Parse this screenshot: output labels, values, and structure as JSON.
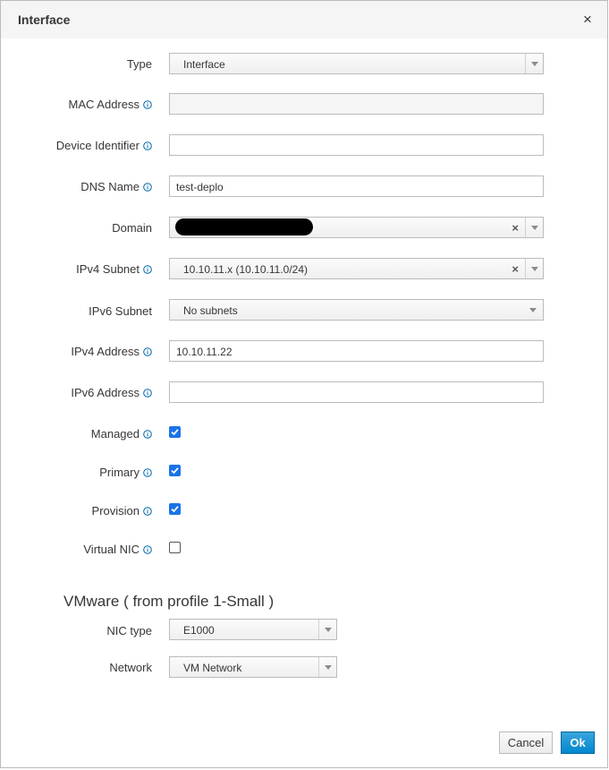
{
  "dialog": {
    "title": "Interface",
    "close_symbol": "×"
  },
  "form": {
    "type": {
      "label": "Type",
      "value": "Interface"
    },
    "mac_address": {
      "label": "MAC Address",
      "value": ""
    },
    "device_identifier": {
      "label": "Device Identifier",
      "value": ""
    },
    "dns_name": {
      "label": "DNS Name",
      "value": "test-deplo"
    },
    "domain": {
      "label": "Domain",
      "value": "",
      "clear_symbol": "×"
    },
    "ipv4_subnet": {
      "label": "IPv4 Subnet",
      "value": "10.10.11.x (10.10.11.0/24)",
      "clear_symbol": "×"
    },
    "ipv6_subnet": {
      "label": "IPv6 Subnet",
      "value": "No subnets"
    },
    "ipv4_address": {
      "label": "IPv4 Address",
      "value": "10.10.11.22"
    },
    "ipv6_address": {
      "label": "IPv6 Address",
      "value": ""
    },
    "managed": {
      "label": "Managed",
      "checked": true
    },
    "primary": {
      "label": "Primary",
      "checked": true
    },
    "provision": {
      "label": "Provision",
      "checked": true
    },
    "virtual_nic": {
      "label": "Virtual NIC",
      "checked": false
    }
  },
  "vmware": {
    "section_title": "VMware ( from profile 1-Small )",
    "nic_type": {
      "label": "NIC type",
      "value": "E1000"
    },
    "network": {
      "label": "Network",
      "value": "VM Network"
    }
  },
  "footer": {
    "cancel_label": "Cancel",
    "ok_label": "Ok"
  },
  "colors": {
    "accent": "#0088ce",
    "checkbox": "#1a73e8",
    "info_icon": "#0066aa"
  },
  "icons": [
    "info-icon",
    "close-icon",
    "chevron-down-icon",
    "clear-icon",
    "check-icon"
  ]
}
